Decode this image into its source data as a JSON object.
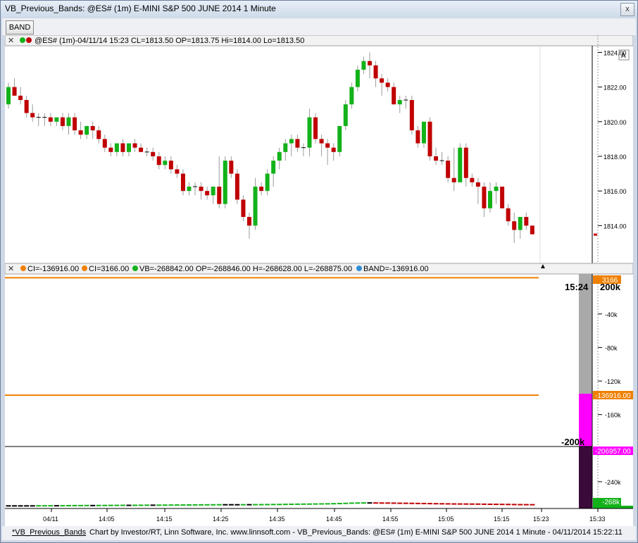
{
  "window": {
    "title": "VB_Previous_Bands: @ES# (1m) E-MINI S&P 500 JUNE 2014 1 Minute",
    "close_glyph": "x"
  },
  "toolbar": {
    "band_label": "BAND"
  },
  "panes": {
    "price_header": "@ES# (1m)-04/11/14 15:23 CL=1813.50 OP=1813.75 Hi=1814.00 Lo=1813.50",
    "price_scale_mode": "A",
    "indicator_header": {
      "ci1": "CI=-136916.00",
      "ci2": "CI=3166.00",
      "vb": "VB=-268842.00 OP=-268846.00 H=-268628.00 L=-268875.00",
      "band": "BAND=-136916.00"
    },
    "time_marker": "15:24",
    "scale_top_label": "200k",
    "scale_low_label": "-200k",
    "markers": {
      "upper": "3166",
      "band": "-136916.00",
      "lower": "-206957.00",
      "vb": "-268k",
      "vb_bottom": "-268875.00"
    }
  },
  "colors": {
    "up": "#13b21a",
    "down": "#c00000",
    "band": "#f08000",
    "magenta": "#ff00ff",
    "gray": "#a9a9a9",
    "dark_purple": "#3a0a3a"
  },
  "chart_data": [
    {
      "type": "candlestick",
      "title": "@ES# (1m)",
      "y_ticks": [
        1814,
        1816,
        1818,
        1820,
        1822,
        1824
      ],
      "y_tick_labels": [
        "1814.00",
        "1816.00",
        "1818.00",
        "1820.00",
        "1822.00",
        "1824.00"
      ],
      "ylim": [
        1811.9,
        1824.3
      ],
      "x_ticks": [
        "04/11",
        "14:05",
        "14:15",
        "14:25",
        "14:35",
        "14:45",
        "14:55",
        "15:05",
        "15:15",
        "15:23",
        "15:33"
      ],
      "last_price": 1813.5,
      "open": [
        1821.0,
        1822.0,
        1821.5,
        1821.25,
        1820.5,
        1820.25,
        1820.25,
        1820.25,
        1820.0,
        1820.25,
        1819.75,
        1820.25,
        1819.5,
        1819.25,
        1819.75,
        1819.5,
        1819.0,
        1818.5,
        1818.25,
        1818.75,
        1818.25,
        1818.75,
        1818.5,
        1818.25,
        1818.25,
        1818.0,
        1817.5,
        1817.75,
        1817.25,
        1817.0,
        1816.0,
        1816.25,
        1816.25,
        1816.0,
        1815.75,
        1816.25,
        1815.25,
        1817.75,
        1817.0,
        1815.5,
        1814.5,
        1814.0,
        1816.25,
        1816.0,
        1817.0,
        1817.75,
        1818.25,
        1818.75,
        1819.0,
        1818.5,
        1818.5,
        1820.25,
        1819.0,
        1818.75,
        1818.5,
        1818.25,
        1819.75,
        1821.0,
        1822.0,
        1823.0,
        1823.5,
        1823.25,
        1822.5,
        1822.25,
        1822.0,
        1821.0,
        1821.25,
        1821.25,
        1819.5,
        1818.75,
        1820.0,
        1818.0,
        1817.75,
        1817.75,
        1816.75,
        1816.5,
        1818.5,
        1816.75,
        1816.5,
        1816.25,
        1815.0,
        1816.0,
        1816.25,
        1815.0,
        1814.25,
        1813.75,
        1814.5,
        1814.0
      ],
      "high": [
        1822.25,
        1822.5,
        1822.0,
        1821.5,
        1821.0,
        1820.5,
        1820.5,
        1820.5,
        1820.25,
        1820.5,
        1820.5,
        1820.5,
        1820.0,
        1819.75,
        1820.0,
        1819.75,
        1819.25,
        1818.75,
        1818.75,
        1819.0,
        1818.75,
        1819.0,
        1818.75,
        1818.5,
        1818.5,
        1818.25,
        1818.0,
        1818.0,
        1817.5,
        1817.25,
        1816.5,
        1816.5,
        1816.5,
        1816.25,
        1816.25,
        1818.0,
        1818.0,
        1818.0,
        1817.25,
        1815.75,
        1814.75,
        1816.75,
        1816.5,
        1817.25,
        1818.0,
        1818.5,
        1819.0,
        1819.25,
        1819.25,
        1818.75,
        1820.75,
        1820.5,
        1819.25,
        1819.0,
        1818.75,
        1819.75,
        1821.25,
        1822.25,
        1823.25,
        1823.75,
        1824.0,
        1823.5,
        1822.75,
        1822.5,
        1822.25,
        1821.5,
        1821.5,
        1821.5,
        1819.75,
        1819.75,
        1820.25,
        1818.5,
        1818.25,
        1818.0,
        1818.5,
        1818.75,
        1818.75,
        1817.0,
        1816.75,
        1816.5,
        1816.5,
        1816.5,
        1816.25,
        1815.25,
        1814.75,
        1814.25,
        1814.75,
        1814.0
      ],
      "low": [
        1820.75,
        1821.5,
        1821.0,
        1820.25,
        1820.0,
        1819.75,
        1819.75,
        1819.75,
        1819.75,
        1819.5,
        1819.25,
        1819.25,
        1819.0,
        1819.0,
        1819.0,
        1818.75,
        1818.25,
        1818.0,
        1818.0,
        1818.0,
        1818.0,
        1818.25,
        1818.25,
        1818.0,
        1817.75,
        1817.25,
        1817.25,
        1817.0,
        1816.75,
        1815.75,
        1815.75,
        1815.75,
        1815.5,
        1815.5,
        1815.25,
        1815.0,
        1815.0,
        1816.75,
        1815.25,
        1814.25,
        1813.25,
        1813.75,
        1815.75,
        1815.75,
        1816.25,
        1817.25,
        1817.75,
        1818.0,
        1818.25,
        1818.0,
        1818.0,
        1818.75,
        1818.0,
        1817.5,
        1817.75,
        1818.0,
        1819.5,
        1820.75,
        1821.75,
        1822.75,
        1822.5,
        1822.0,
        1821.5,
        1821.75,
        1821.0,
        1820.5,
        1820.75,
        1819.25,
        1818.5,
        1818.5,
        1817.75,
        1817.5,
        1817.5,
        1816.5,
        1816.0,
        1816.5,
        1816.25,
        1816.25,
        1815.25,
        1814.5,
        1814.75,
        1815.25,
        1815.0,
        1814.0,
        1813.0,
        1813.25,
        1813.75,
        1813.5
      ],
      "close": [
        1822.0,
        1821.5,
        1821.25,
        1820.5,
        1820.25,
        1820.25,
        1820.25,
        1820.0,
        1820.25,
        1819.75,
        1820.25,
        1819.5,
        1819.25,
        1819.75,
        1819.5,
        1819.0,
        1818.5,
        1818.25,
        1818.75,
        1818.25,
        1818.75,
        1818.5,
        1818.25,
        1818.25,
        1818.0,
        1817.5,
        1817.75,
        1817.25,
        1817.0,
        1816.0,
        1816.25,
        1816.25,
        1816.0,
        1815.75,
        1816.25,
        1815.25,
        1817.75,
        1817.0,
        1815.5,
        1814.5,
        1814.0,
        1816.25,
        1816.0,
        1817.0,
        1817.75,
        1818.25,
        1818.75,
        1819.0,
        1818.5,
        1818.5,
        1820.25,
        1819.0,
        1818.75,
        1818.5,
        1818.25,
        1819.75,
        1821.0,
        1822.0,
        1823.0,
        1823.5,
        1823.25,
        1822.5,
        1822.25,
        1822.0,
        1821.0,
        1821.25,
        1821.25,
        1819.5,
        1818.75,
        1820.0,
        1818.0,
        1817.75,
        1817.75,
        1816.75,
        1816.5,
        1818.5,
        1816.75,
        1816.5,
        1816.25,
        1815.0,
        1816.0,
        1816.25,
        1815.0,
        1814.25,
        1813.75,
        1814.5,
        1814.0,
        1813.5
      ]
    },
    {
      "type": "line",
      "title": "VB_Previous_Bands",
      "y_tick_labels": [
        "-40k",
        "-80k",
        "-120k",
        "-160k",
        "-200k",
        "-240k"
      ],
      "y_ticks": [
        -40000,
        -80000,
        -120000,
        -160000,
        -200000,
        -240000
      ],
      "series": [
        {
          "name": "CI",
          "values": [
            -136916,
            -136916
          ]
        },
        {
          "name": "CI",
          "values": [
            3166,
            3166
          ]
        },
        {
          "name": "BAND",
          "values": [
            -136916,
            -136916
          ]
        }
      ],
      "vb_offsets": [
        0,
        0,
        0,
        0,
        0,
        50,
        100,
        150,
        150,
        200,
        250,
        300,
        350,
        400,
        400,
        450,
        500,
        550,
        600,
        650,
        650,
        700,
        750,
        800,
        800,
        850,
        900,
        950,
        1000,
        1050,
        1100,
        1150,
        1200,
        1250,
        1300,
        1350,
        1350,
        1350,
        1350,
        1400,
        1400,
        1450,
        1500,
        1550,
        1600,
        1700,
        1800,
        1900,
        2000,
        2100,
        2150,
        2250,
        2350,
        2450,
        2600,
        2750,
        3000,
        3250,
        3400,
        3500,
        3500,
        3450,
        3400,
        3350,
        3250,
        3150,
        3100,
        3000,
        2900,
        2800,
        2700,
        2600,
        2500,
        2400,
        2300,
        2250,
        2200,
        2150,
        2100,
        2000,
        1900,
        1850,
        1800,
        1700,
        1600,
        1500,
        1450,
        1400
      ],
      "vb_base": -268875,
      "ylim": [
        -270300,
        6000
      ]
    }
  ]
}
